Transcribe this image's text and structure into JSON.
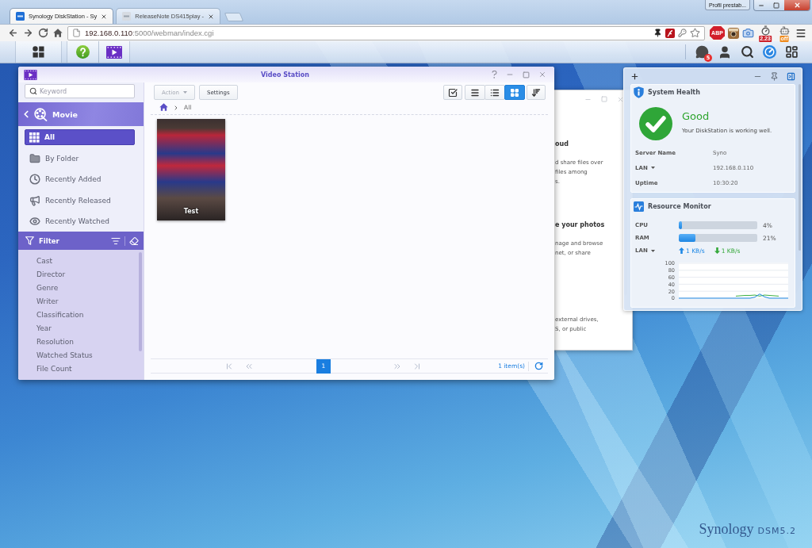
{
  "browser": {
    "tabs": [
      {
        "title": "Synology DiskStation - Sy",
        "selected": true
      },
      {
        "title": "ReleaseNote DS415play -",
        "selected": false
      }
    ],
    "profile": "Profil prestab...",
    "address": {
      "host": "192.168.0.110",
      "path": ":5000/webman/index.cgi"
    },
    "extensions": [
      {
        "kind": "abp",
        "label": "ABP"
      },
      {
        "kind": "instagram"
      },
      {
        "kind": "camera"
      },
      {
        "kind": "timer",
        "label": "2.23"
      },
      {
        "kind": "robot",
        "label": "off"
      }
    ]
  },
  "taskbar": {
    "apps": [
      {
        "kind": "main-menu"
      },
      {
        "kind": "help"
      },
      {
        "kind": "video-station"
      }
    ],
    "notification_count": "5"
  },
  "video_station": {
    "title": "Video Station",
    "search": {
      "placeholder": "Keyword"
    },
    "library": "Movie",
    "nav": [
      {
        "kind": "all",
        "label": "All",
        "selected": true
      },
      {
        "kind": "folder",
        "label": "By Folder",
        "selected": false
      },
      {
        "kind": "added",
        "label": "Recently Added",
        "selected": false
      },
      {
        "kind": "released",
        "label": "Recently Released",
        "selected": false
      },
      {
        "kind": "watched",
        "label": "Recently Watched",
        "selected": false
      }
    ],
    "filter": {
      "title": "Filter",
      "items": [
        "Cast",
        "Director",
        "Genre",
        "Writer",
        "Classification",
        "Year",
        "Resolution",
        "Watched Status",
        "File Count"
      ]
    },
    "actions": [
      {
        "label": "Action",
        "dropdown": true,
        "disabled": true
      },
      {
        "label": "Settings",
        "dropdown": false,
        "disabled": false
      }
    ],
    "views": [
      {
        "kind": "list",
        "selected": false
      },
      {
        "kind": "detail",
        "selected": false
      },
      {
        "kind": "thumbnail",
        "selected": true
      }
    ],
    "breadcrumb": [
      "All"
    ],
    "videos": [
      {
        "title": "Test"
      }
    ],
    "pager": {
      "pages": [
        {
          "label": "1",
          "selected": true
        }
      ],
      "count": "1 item(s)"
    }
  },
  "background_window": {
    "sections": [
      {
        "heading": "oud",
        "lines": [
          "d share files over",
          "files among",
          "s."
        ]
      },
      {
        "heading": "e your photos",
        "lines": [
          "nage and browse",
          "net, or share"
        ]
      },
      {
        "lines": [
          "external drives,",
          "S, or public"
        ]
      }
    ]
  },
  "widgets": {
    "system_health": {
      "title": "System Health",
      "status": "Good",
      "message": "Your DiskStation is working well.",
      "rows": [
        {
          "label": "Server Name",
          "value": "Syno",
          "dropdown": false
        },
        {
          "label": "LAN",
          "value": "192.168.0.110",
          "dropdown": true
        },
        {
          "label": "Uptime",
          "value": "10:30:20",
          "dropdown": false
        }
      ]
    },
    "resource_monitor": {
      "title": "Resource Monitor",
      "meters": [
        {
          "label": "CPU",
          "level": 0.04,
          "reading": "4%"
        },
        {
          "label": "RAM",
          "level": 0.21,
          "reading": "21%"
        }
      ],
      "network": {
        "label": "LAN",
        "dropdown": true,
        "upload": "1 KB/s",
        "download": "1 KB/s"
      },
      "chart_data": {
        "type": "line",
        "ylim": [
          0,
          100
        ],
        "yticks": [
          0,
          20,
          40,
          60,
          80,
          100
        ],
        "grid": true,
        "series": [
          {
            "color": "#1e88e5",
            "values": [
              0,
              0,
              0,
              0,
              0,
              0,
              0,
              0,
              0,
              0,
              0,
              0,
              0,
              0,
              0,
              0,
              3,
              12,
              4,
              0,
              0,
              0,
              0,
              0
            ]
          },
          {
            "color": "#3cb043",
            "values": [
              null,
              null,
              null,
              null,
              null,
              null,
              null,
              null,
              null,
              null,
              null,
              null,
              6,
              7,
              8,
              8,
              9,
              6,
              9,
              8,
              7,
              6,
              null,
              null
            ]
          }
        ]
      }
    }
  },
  "desktop_logo": {
    "brand": "Synology",
    "version": "DSM5.2"
  }
}
